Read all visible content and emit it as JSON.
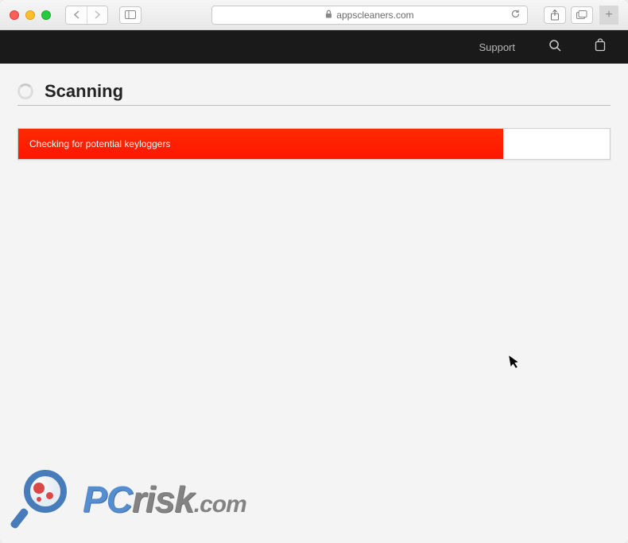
{
  "browser": {
    "url_display": "appscleaners.com"
  },
  "site_nav": {
    "support": "Support"
  },
  "page": {
    "title": "Scanning",
    "progress_text": "Checking for potential keyloggers",
    "progress_percent": 82
  },
  "watermark": {
    "pc": "PC",
    "risk": "risk",
    "suffix": ".com"
  }
}
